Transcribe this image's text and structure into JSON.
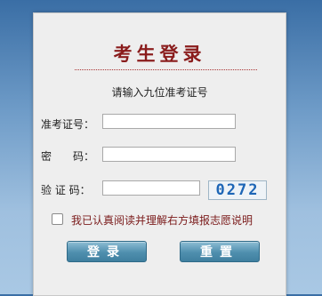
{
  "login": {
    "title": "考生登录",
    "subtitle": "请输入九位准考证号",
    "fields": {
      "exam_number": {
        "label": "准考证号：",
        "value": ""
      },
      "password": {
        "label": "密　　码：",
        "value": ""
      },
      "captcha": {
        "label": "验 证 码：",
        "value": "",
        "code": "0272"
      }
    },
    "agreement": {
      "checked": false,
      "text": "我已认真阅读并理解右方填报志愿说明"
    },
    "buttons": {
      "login": "登录",
      "reset": "重置"
    }
  }
}
